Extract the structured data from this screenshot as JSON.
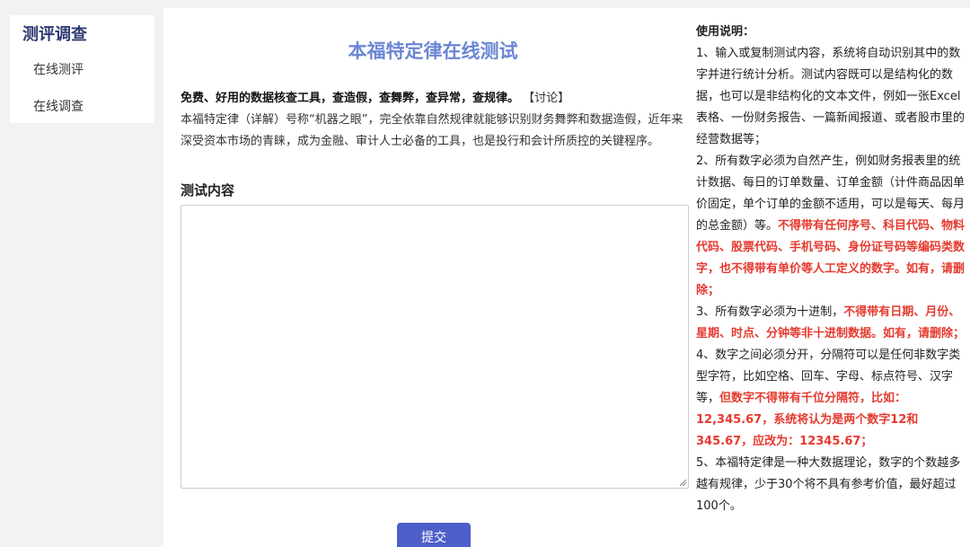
{
  "sidebar": {
    "title": "测评调查",
    "items": [
      {
        "label": "在线测评"
      },
      {
        "label": "在线调查"
      }
    ]
  },
  "main": {
    "title": "本福特定律在线测试",
    "intro_bold": "免费、好用的数据核查工具，查造假，查舞弊，查异常，查规律。",
    "intro_link": "【讨论】",
    "intro_text": "本福特定律（详解）号称“机器之眼”，完全依靠自然规律就能够识别财务舞弊和数据造假，近年来深受资本市场的青睐，成为金融、审计人士必备的工具，也是投行和会计所质控的关键程序。",
    "input_label": "测试内容",
    "textarea_value": "",
    "submit_label": "提交"
  },
  "instructions": {
    "heading": "使用说明：",
    "p1": "1、输入或复制测试内容，系统将自动识别其中的数字并进行统计分析。测试内容既可以是结构化的数据，也可以是非结构化的文本文件，例如一张Excel表格、一份财务报告、一篇新闻报道、或者股市里的经营数据等；",
    "p2_normal": "2、所有数字必须为自然产生，例如财务报表里的统计数据、每日的订单数量、订单金额（计件商品因单价固定，单个订单的金额不适用，可以是每天、每月的总金额）等。",
    "p2_red": "不得带有任何序号、科目代码、物料代码、股票代码、手机号码、身份证号码等编码类数字，也不得带有单价等人工定义的数字。如有，请删除；",
    "p3_normal": "3、所有数字必须为十进制，",
    "p3_red": "不得带有日期、月份、星期、时点、分钟等非十进制数据。如有，请删除；",
    "p4_normal": "4、数字之间必须分开，分隔符可以是任何非数字类型字符，比如空格、回车、字母、标点符号、汉字等，",
    "p4_red": "但数字不得带有千位分隔符，比如：12,345.67，系统将认为是两个数字12和345.67，应改为：12345.67；",
    "p5": "5、本福特定律是一种大数据理论，数字的个数越多越有规律，少于30个将不具有参考价值，最好超过100个。"
  },
  "colors": {
    "title": "#6b86d4",
    "sidebar_title": "#2f3a73",
    "button": "#4f5fc9",
    "warning": "#e53a2f"
  }
}
